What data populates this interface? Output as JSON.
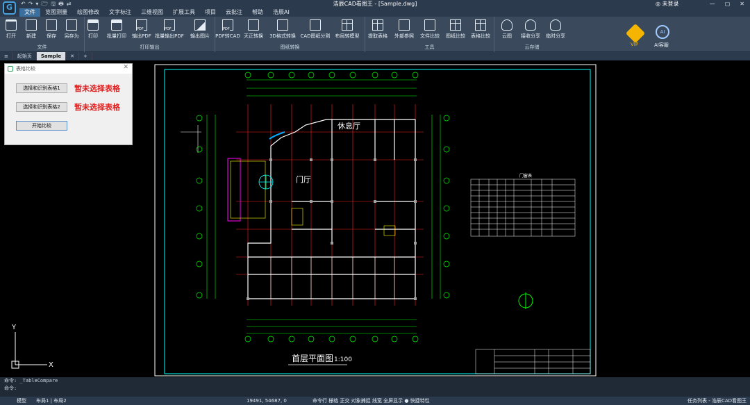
{
  "app": {
    "title": "浩辰CAD看图王 - [Sample.dwg]",
    "logo": "G",
    "user": "◎ 未登录",
    "window_controls": [
      "—",
      "▢",
      "✕"
    ]
  },
  "quick_access": [
    "↶",
    "↷",
    "▾",
    "🗁",
    "🖫",
    "🖶",
    "⇄"
  ],
  "menu": [
    "文件",
    "览图测量",
    "绘图修改",
    "文字标注",
    "三维视图",
    "扩展工具",
    "项目",
    "云批注",
    "帮助",
    "浩辰AI"
  ],
  "ribbon": {
    "groups": [
      {
        "label": "文件",
        "buttons": [
          "打开",
          "新建",
          "保存",
          "另存为"
        ]
      },
      {
        "label": "打印输出",
        "buttons": [
          "打印",
          "批量打印",
          "输出PDF",
          "批量输出PDF",
          "输出图片"
        ]
      },
      {
        "label": "图纸转换",
        "buttons": [
          "PDF转CAD",
          "天正转换",
          "3D格式转换",
          "CAD图纸分割",
          "布局转模型"
        ]
      },
      {
        "label": "工具",
        "buttons": [
          "提取表格",
          "外部参照",
          "文件比较",
          "图纸比较",
          "表格比较"
        ]
      },
      {
        "label": "云存储",
        "buttons": [
          "云图",
          "接收分享",
          "临时分享"
        ]
      }
    ],
    "vip_label": "VIP",
    "ai_label": "AI客服",
    "ai_badge": "AI"
  },
  "tabs": [
    "≡",
    "起始页",
    "Sample",
    "✕",
    "+"
  ],
  "dialog": {
    "title": "表格比较",
    "close": "✕",
    "select1": "选择和识别表格1",
    "status1": "暂未选择表格",
    "select2": "选择和识别表格2",
    "status2": "暂未选择表格",
    "start": "开始比较"
  },
  "drawing": {
    "room1": "休息厅",
    "room2": "门厅",
    "table_title": "门窗表",
    "plan_title": "首层平面图",
    "plan_scale": "1:100",
    "axis_y": "Y",
    "axis_x": "X"
  },
  "command": {
    "line1": "命令: _TableCompare",
    "line2": "命令:"
  },
  "status": {
    "model": "模型",
    "layouts": "布局1 | 布局2",
    "coords": "19491, 54687, 0",
    "toggles": "命令行  栅格  正交  对象捕捉  线宽  全屏显示  ● 快捷特性",
    "right": "任务列表 - 浩辰CAD看图王"
  }
}
